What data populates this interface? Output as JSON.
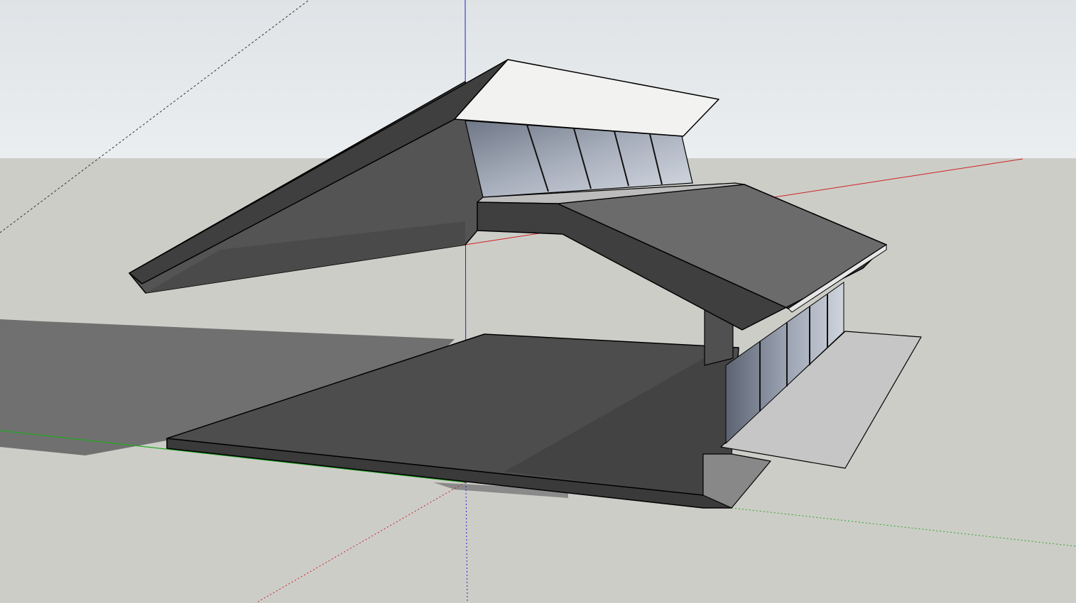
{
  "viewport": {
    "sky_top_color": "#dfe3e6",
    "sky_bottom_color": "#e9ecee",
    "ground_color": "#cdcdc8",
    "shadow_color": "#707070"
  },
  "axes": {
    "red_axis_color": "#cc2222",
    "green_axis_color": "#22aa22",
    "blue_axis_color": "#2222cc"
  },
  "model": {
    "roof_dark_color": "#3e3e3e",
    "roof_mid_color": "#6a6a6a",
    "floor_color": "#4a4a4a",
    "soffit_white_color": "#f2f2f0",
    "glass_color": "#8f98a8",
    "step_color": "#c8c8c8"
  }
}
